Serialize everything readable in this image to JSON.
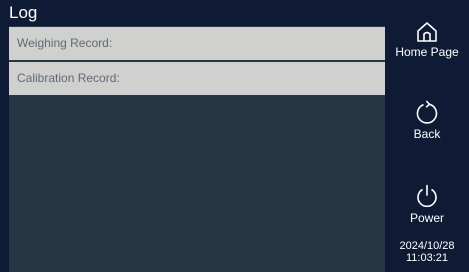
{
  "header": {
    "title": "Log"
  },
  "records": [
    {
      "label": "Weighing Record:"
    },
    {
      "label": "Calibration Record:"
    }
  ],
  "sidebar": {
    "home": {
      "label": "Home Page",
      "icon": "home-icon"
    },
    "back": {
      "label": "Back",
      "icon": "refresh-back-icon"
    },
    "power": {
      "label": "Power",
      "icon": "power-icon"
    }
  },
  "status": {
    "date": "2024/10/28",
    "time": "11:03:21"
  },
  "colors": {
    "background": "#0f1b34",
    "content_area": "#253644",
    "row_background": "#d0d0ce",
    "row_text": "#5f6b73",
    "text": "#ffffff"
  }
}
